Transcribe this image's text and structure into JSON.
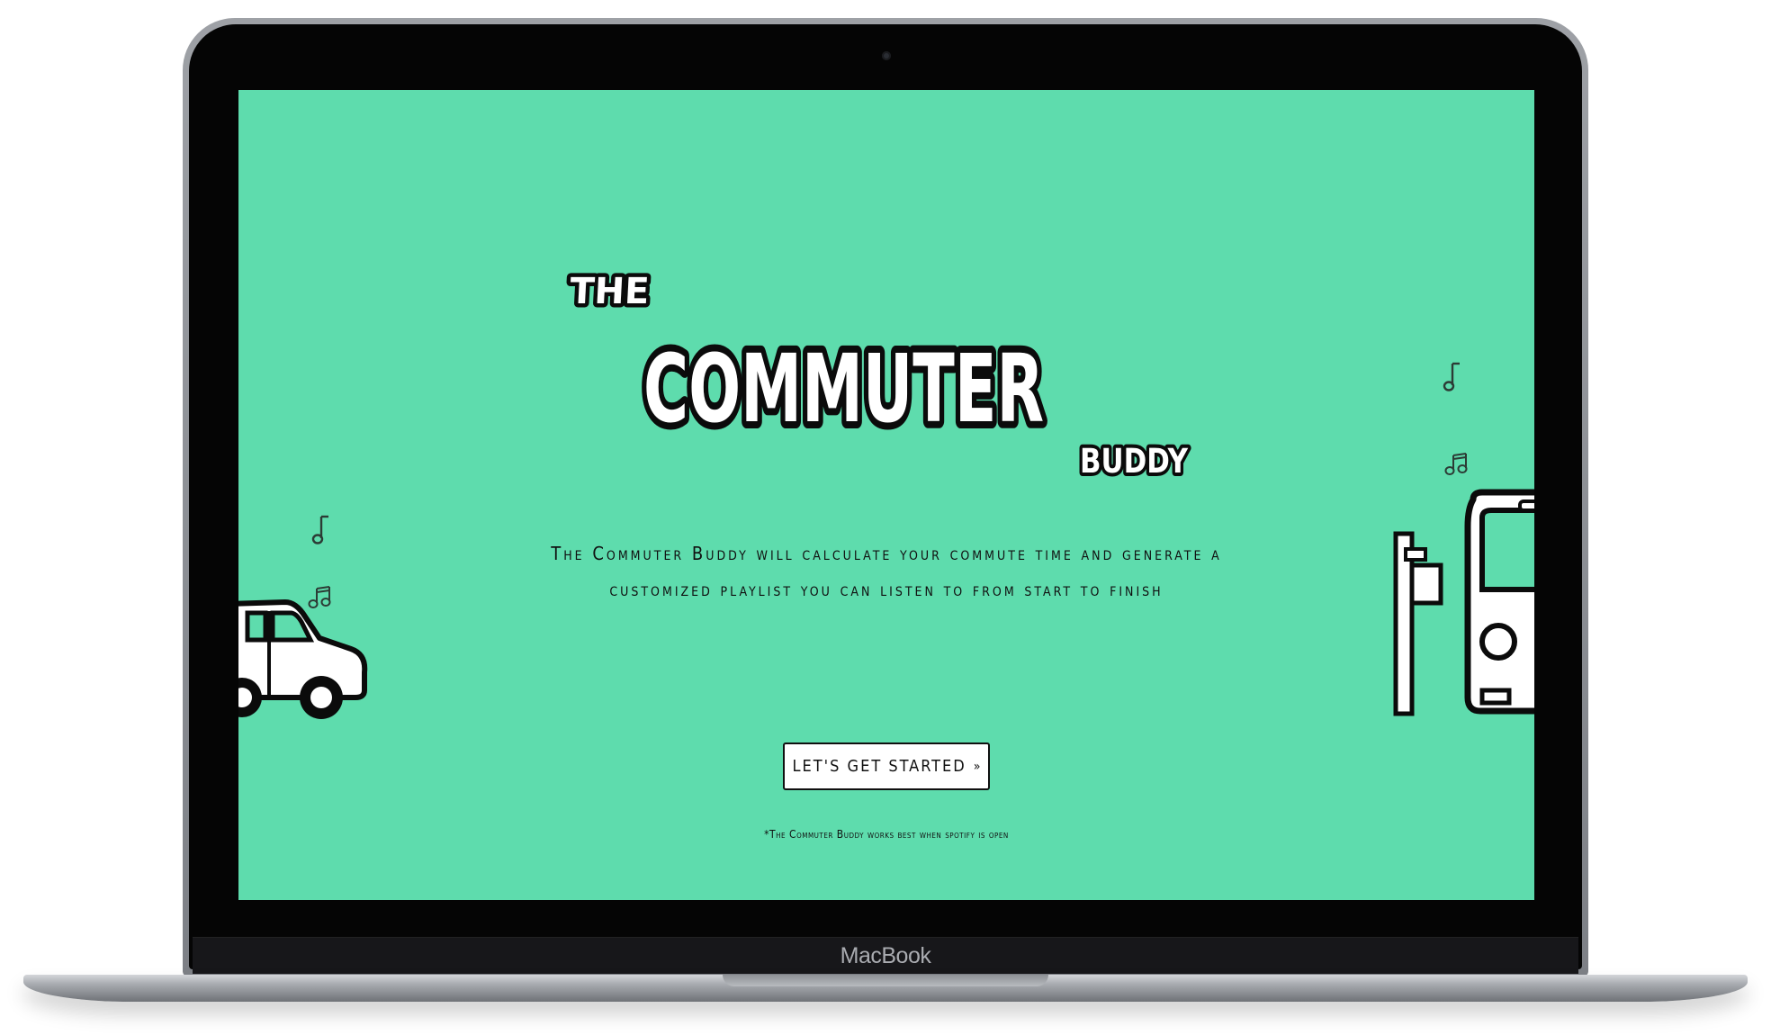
{
  "device": {
    "brand_label": "MacBook"
  },
  "app": {
    "logo": {
      "line_the": "THE",
      "line_main": "COMMUTER",
      "line_buddy": "BUDDY"
    },
    "tagline": {
      "line1": "The Commuter Buddy will calculate your commute time and generate a",
      "line2": "customized playlist you can listen to from start to finish"
    },
    "cta": {
      "label": "LET'S GET STARTED",
      "icon": "chevron-double-down-icon"
    },
    "footnote": "*The Commuter Buddy works best when spotify is open"
  },
  "icons": {
    "left_notes": [
      "music-note-icon",
      "music-notes-icon"
    ],
    "right_notes": [
      "music-note-icon",
      "music-notes-icon"
    ],
    "car": "car-icon",
    "bus": "bus-icon",
    "bus_stop": "bus-stop-sign-icon"
  },
  "colors": {
    "screen_background": "#5edcad",
    "ink": "#101010",
    "button_background": "#ffffff"
  }
}
